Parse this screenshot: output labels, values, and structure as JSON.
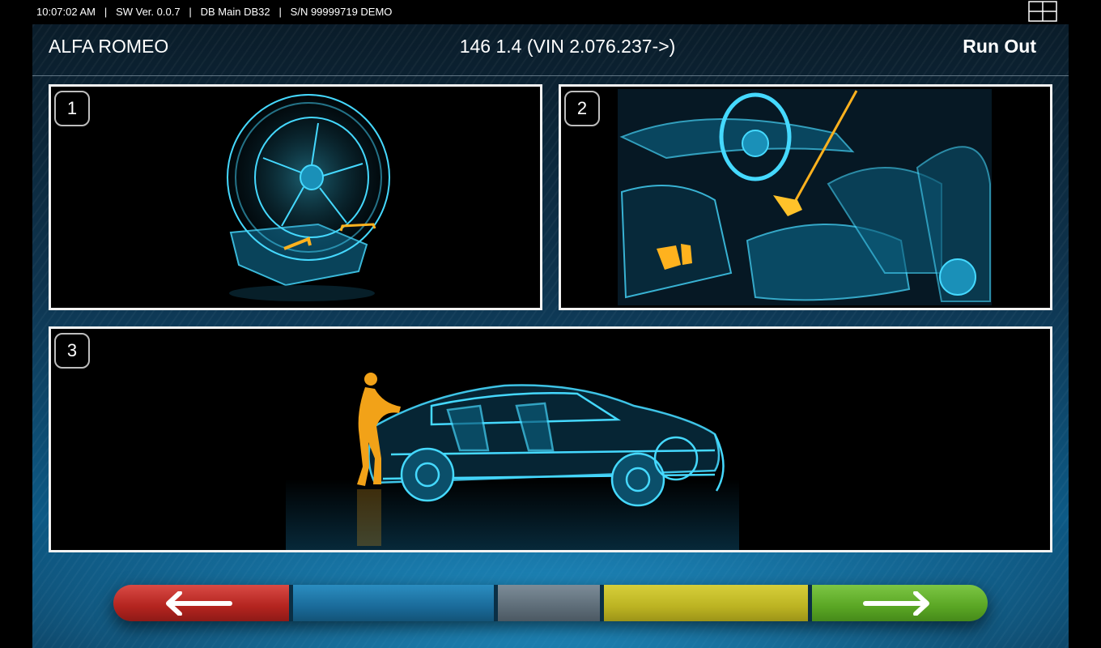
{
  "statusbar": {
    "time": "10:07:02 AM",
    "sw_version": "SW Ver. 0.0.7",
    "database": "DB Main DB32",
    "serial": "S/N 99999719 DEMO",
    "separator": "   |   ",
    "grid_icon": "grid-layout-icon"
  },
  "header": {
    "brand": "ALFA ROMEO",
    "model": "146 1.4 (VIN 2.076.237->)",
    "mode": "Run Out"
  },
  "panels": [
    {
      "step": "1",
      "illustration": "wheel on turntable with clamp"
    },
    {
      "step": "2",
      "illustration": "car interior with steering wheel lock and brake pedal press"
    },
    {
      "step": "3",
      "illustration": "person pushing vehicle"
    }
  ],
  "nav": {
    "back_icon": "arrow-left-icon",
    "next_icon": "arrow-right-icon",
    "colors": {
      "red": "#b3241f",
      "blue": "#1a6b9a",
      "gray": "#5e6d78",
      "yellow": "#bcb322",
      "green": "#5aa624"
    }
  }
}
